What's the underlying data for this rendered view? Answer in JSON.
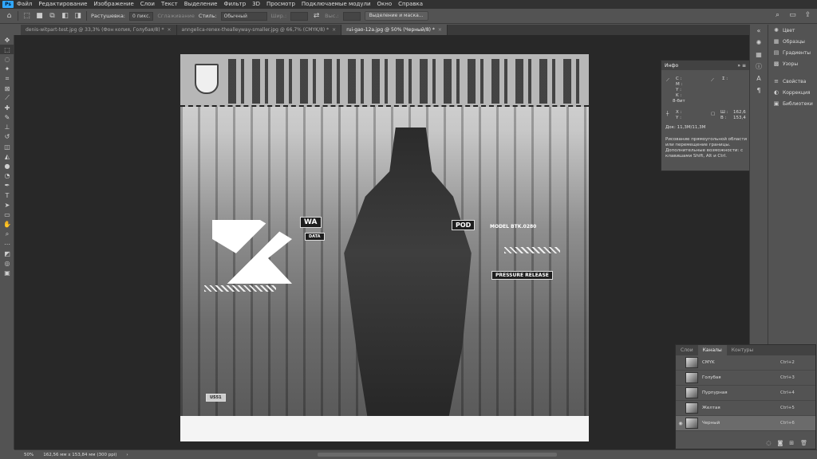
{
  "menubar": {
    "logo": "Ps",
    "items": [
      "Файл",
      "Редактирование",
      "Изображение",
      "Слои",
      "Текст",
      "Выделение",
      "Фильтр",
      "3D",
      "Просмотр",
      "Подключаемые модули",
      "Окно",
      "Справка"
    ]
  },
  "options": {
    "feather_label": "Растушевка:",
    "feather_value": "0 пикс.",
    "antialias_label": "Сглаживание",
    "style_label": "Стиль:",
    "style_value": "Обычный",
    "width_label": "Шир.:",
    "height_label": "Выс.:",
    "select_mask_button": "Выделение и маска..."
  },
  "tabs": [
    {
      "label": "denis-witpart-test.jpg @ 33,3% (Фон копия, Голубая/8) *",
      "active": false
    },
    {
      "label": "anngelica-renex-thealleyway-smaller.jpg @ 66,7% (CMYK/8) *",
      "active": false
    },
    {
      "label": "rui-gao-12a.jpg @ 50% (Черный/8) *",
      "active": true
    }
  ],
  "canvas_tags": {
    "wa": "WA",
    "data": "DATA",
    "pod": "POD",
    "model": "MODEL BTK.0280",
    "pressure": "PRESSURE RELEASE",
    "plate": "US51"
  },
  "info_panel": {
    "title": "Инфо",
    "c": "C :",
    "m": "M :",
    "y": "Y :",
    "k": "K :",
    "bits": "8-бит",
    "x": "X :",
    "y2": "Y :",
    "w_label": "Ш :",
    "w_value": "162,6",
    "h_label": "В :",
    "h_value": "153,4",
    "doc": "Док: 11,3M/11,3M",
    "desc": "Рисование прямоугольной области или перемещение границы. Дополнительные возможности: с клавишами Shift, Alt и Ctrl."
  },
  "dock": {
    "items": [
      "Цвет",
      "Образцы",
      "Градиенты",
      "Узоры",
      "Свойства",
      "Коррекция",
      "Библиотеки"
    ]
  },
  "channels": {
    "tabs": [
      "Слои",
      "Каналы",
      "Контуры"
    ],
    "active_tab": "Каналы",
    "rows": [
      {
        "name": "CMYK",
        "shortcut": "Ctrl+2",
        "visible": false,
        "selected": false
      },
      {
        "name": "Голубая",
        "shortcut": "Ctrl+3",
        "visible": false,
        "selected": false
      },
      {
        "name": "Пурпурная",
        "shortcut": "Ctrl+4",
        "visible": false,
        "selected": false
      },
      {
        "name": "Желтая",
        "shortcut": "Ctrl+5",
        "visible": false,
        "selected": false
      },
      {
        "name": "Черный",
        "shortcut": "Ctrl+6",
        "visible": true,
        "selected": true
      }
    ]
  },
  "status": {
    "zoom": "50%",
    "size": "162,56 мм x 153,84 мм (300 ppi)"
  }
}
